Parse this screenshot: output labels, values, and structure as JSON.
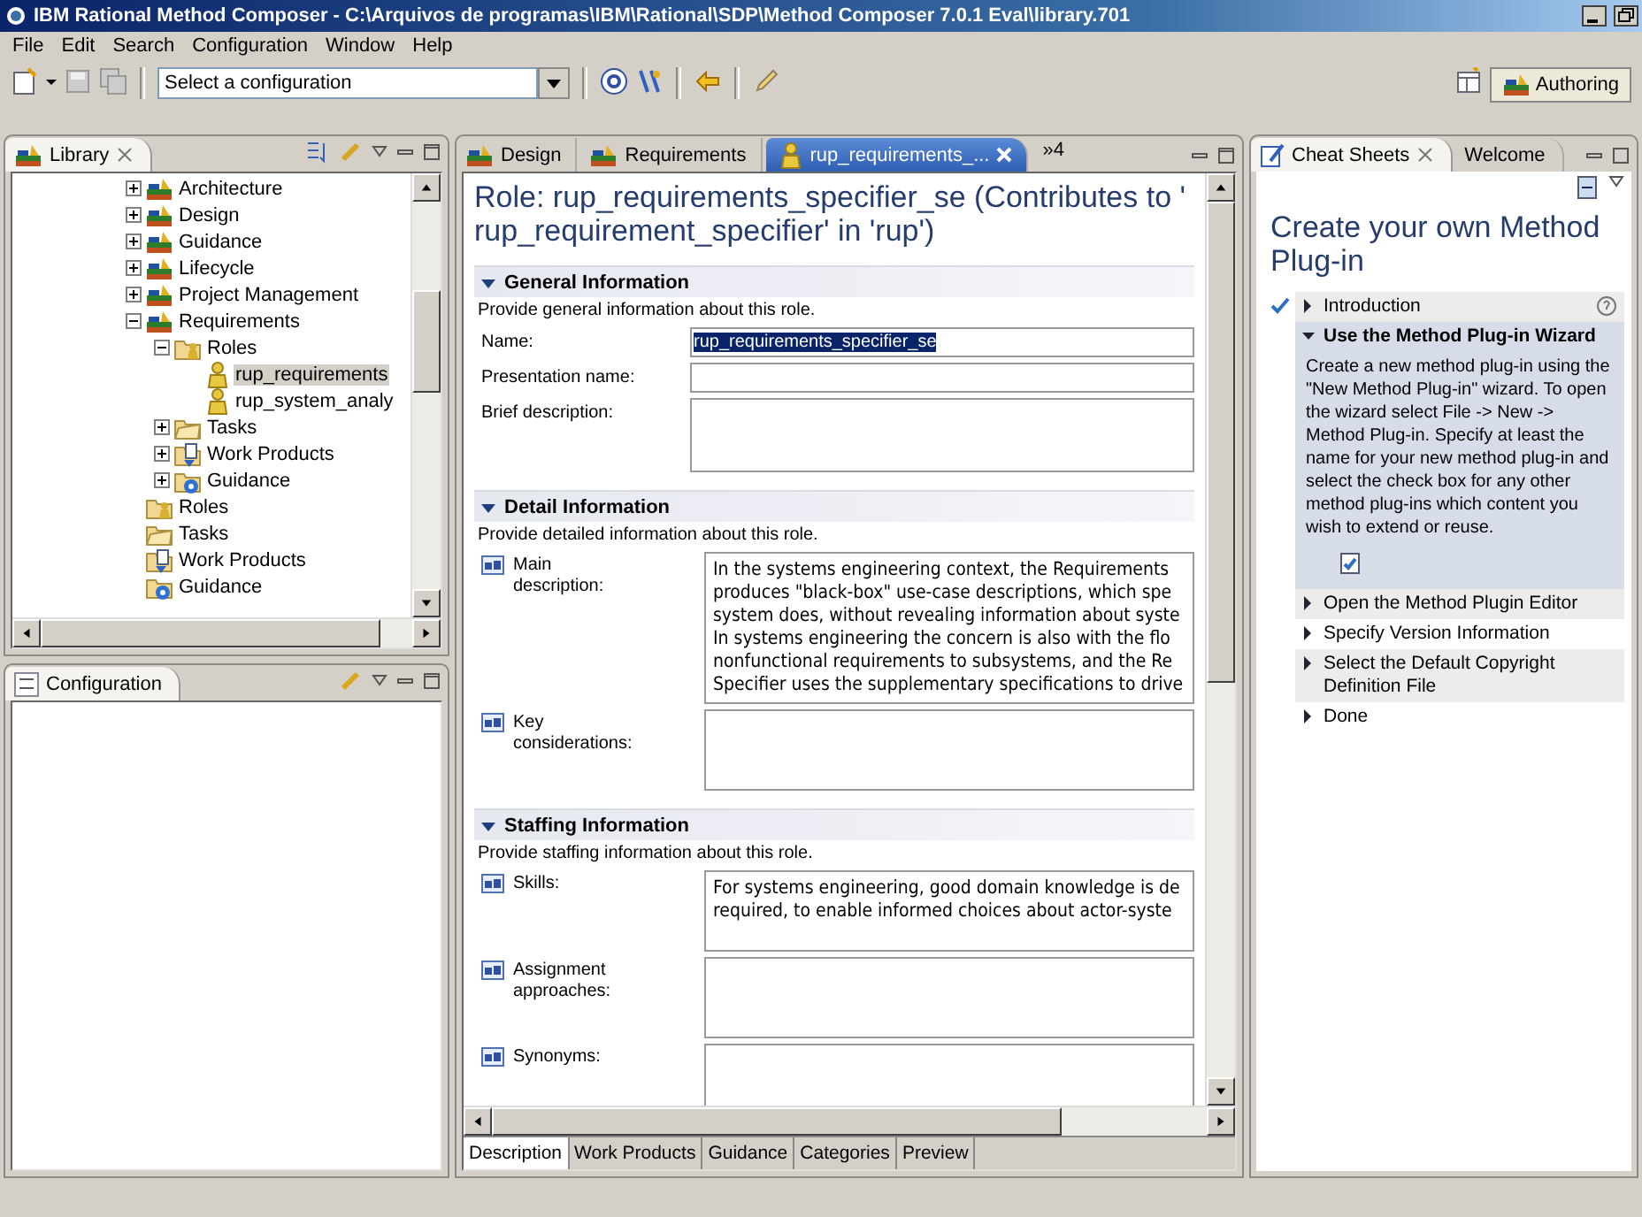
{
  "window": {
    "title": "IBM Rational Method Composer - C:\\Arquivos de programas\\IBM\\Rational\\SDP\\Method Composer 7.0.1 Eval\\library.701"
  },
  "menu": [
    "File",
    "Edit",
    "Search",
    "Configuration",
    "Window",
    "Help"
  ],
  "toolbar": {
    "configuration": {
      "value": "Select a configuration"
    },
    "perspective": {
      "label": "Authoring",
      "selected": true
    }
  },
  "library": {
    "title": "Library",
    "tree": [
      {
        "label": "Architecture",
        "kind": "plugin",
        "expanded": false,
        "selected": false
      },
      {
        "label": "Design",
        "kind": "plugin",
        "expanded": false,
        "selected": false
      },
      {
        "label": "Guidance",
        "kind": "plugin",
        "expanded": false,
        "selected": false
      },
      {
        "label": "Lifecycle",
        "kind": "plugin",
        "expanded": false,
        "selected": false
      },
      {
        "label": "Project Management",
        "kind": "plugin",
        "expanded": false,
        "selected": false
      },
      {
        "label": "Requirements",
        "kind": "plugin",
        "expanded": true,
        "selected": false,
        "children": [
          {
            "label": "Roles",
            "kind": "roles-folder",
            "expanded": true,
            "selected": false,
            "children": [
              {
                "label": "rup_requirements",
                "kind": "role",
                "selected": true
              },
              {
                "label": "rup_system_analy",
                "kind": "role",
                "selected": false
              }
            ]
          },
          {
            "label": "Tasks",
            "kind": "tasks-folder",
            "expanded": false,
            "selected": false
          },
          {
            "label": "Work Products",
            "kind": "workproducts-folder",
            "expanded": false,
            "selected": false
          },
          {
            "label": "Guidance",
            "kind": "guidance-folder",
            "expanded": false,
            "selected": false
          }
        ]
      },
      {
        "label": "Roles",
        "kind": "roles-folder",
        "selected": false
      },
      {
        "label": "Tasks",
        "kind": "tasks-folder",
        "selected": false
      },
      {
        "label": "Work Products",
        "kind": "workproducts-folder",
        "selected": false
      },
      {
        "label": "Guidance",
        "kind": "guidance-folder",
        "selected": false
      }
    ]
  },
  "configuration_view": {
    "title": "Configuration"
  },
  "editor": {
    "tabs": [
      {
        "label": "Design",
        "kind": "plugin",
        "selected": false
      },
      {
        "label": "Requirements",
        "kind": "plugin",
        "selected": false
      },
      {
        "label": "rup_requirements_...",
        "kind": "role",
        "selected": true
      }
    ],
    "overflow": "»4",
    "heading": "Role: rup_requirements_specifier_se (Contributes to ' rup_requirement_specifier' in 'rup')",
    "sections": [
      {
        "title": "General Information",
        "description": "Provide general information about this role.",
        "fields": [
          {
            "label": "Name:",
            "kind": "text",
            "value": "rup_requirements_specifier_se",
            "highlighted": true
          },
          {
            "label": "Presentation name:",
            "kind": "text"
          },
          {
            "label": "Brief description:",
            "kind": "area"
          }
        ]
      },
      {
        "title": "Detail Information",
        "description": "Provide detailed information about this role.",
        "fields": [
          {
            "label": "Main description:",
            "kind": "rich",
            "lines": [
              "In the systems engineering context, the Requirements",
              "produces \"black-box\" use-case descriptions, which spe",
              "system does, without revealing information about syste",
              "In systems engineering the concern is also with the flo",
              "nonfunctional requirements to subsystems, and the Re",
              "Specifier uses the supplementary specifications to drive"
            ]
          },
          {
            "label": "Key considerations:",
            "kind": "rich"
          }
        ]
      },
      {
        "title": "Staffing Information",
        "description": "Provide staffing information about this role.",
        "fields": [
          {
            "label": "Skills:",
            "kind": "rich",
            "lines": [
              "For systems engineering, good domain knowledge is de",
              "required, to enable informed choices about actor-syste"
            ]
          },
          {
            "label": "Assignment approaches:",
            "kind": "rich"
          },
          {
            "label": "Synonyms:",
            "kind": "rich"
          }
        ]
      }
    ],
    "bottom_tabs": [
      {
        "label": "Description",
        "selected": true
      },
      {
        "label": "Work Products",
        "selected": false
      },
      {
        "label": "Guidance",
        "selected": false
      },
      {
        "label": "Categories",
        "selected": false
      },
      {
        "label": "Preview",
        "selected": false
      }
    ]
  },
  "cheat_sheet": {
    "tabs": [
      {
        "label": "Cheat Sheets",
        "selected": true
      },
      {
        "label": "Welcome",
        "selected": false
      }
    ],
    "heading": "Create your own Method Plug-in",
    "steps": [
      {
        "label": "Introduction",
        "completed": true,
        "expanded": false,
        "help": true
      },
      {
        "label": "Use the Method Plug-in Wizard",
        "completed": false,
        "expanded": true,
        "help": false,
        "body": "Create a new method plug-in using the \"New Method Plug-in\" wizard. To open the wizard select File -> New -> Method Plug-in. Specify at least the name for your new method plug-in and select the check box for any other method plug-ins which content you wish to extend or reuse."
      },
      {
        "label": "Open the Method Plugin Editor",
        "completed": false,
        "expanded": false,
        "help": false
      },
      {
        "label": "Specify Version Information",
        "completed": false,
        "expanded": false,
        "help": false
      },
      {
        "label": "Select the Default Copyright Definition File",
        "completed": false,
        "expanded": false,
        "help": false
      },
      {
        "label": "Done",
        "completed": false,
        "expanded": false,
        "help": false
      }
    ]
  }
}
